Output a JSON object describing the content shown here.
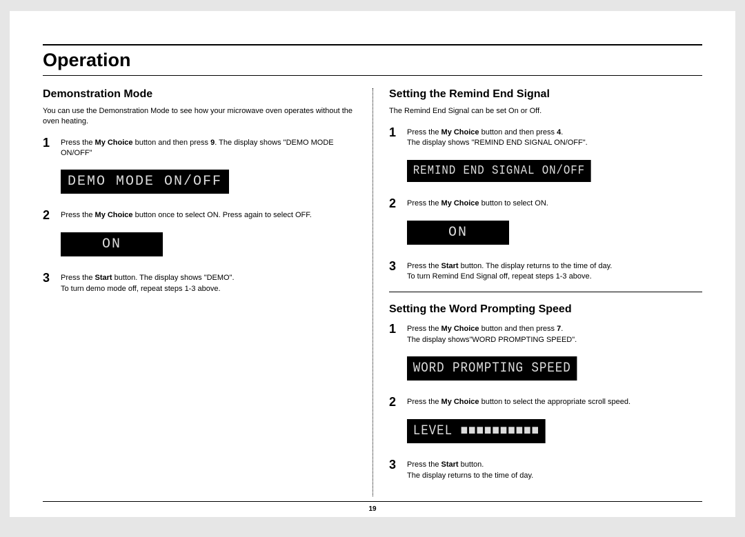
{
  "section_title": "Operation",
  "page_number": "19",
  "left": {
    "demo": {
      "heading": "Demonstration Mode",
      "intro": "You can use the Demonstration Mode to see how your microwave oven operates without the oven heating.",
      "s1_pre": "Press the ",
      "s1_btn": "My Choice",
      "s1_mid": " button and then press ",
      "s1_num": "9",
      "s1_post": ". The display shows \"DEMO MODE ON/OFF\"",
      "lcd1": "DEMO MODE ON/OFF",
      "s2_pre": "Press the ",
      "s2_btn": "My Choice",
      "s2_post": " button once to select ON. Press again to select OFF.",
      "lcd2": "ON",
      "s3_pre": "Press the ",
      "s3_btn": "Start",
      "s3_mid": " button. The display shows \"DEMO\".",
      "s3_line2": "To turn demo mode off, repeat steps 1-3 above."
    }
  },
  "right": {
    "remind": {
      "heading": "Setting the Remind End Signal",
      "intro": "The Remind End Signal can be set On or Off.",
      "s1_pre": "Press the ",
      "s1_btn": "My Choice",
      "s1_mid": " button and then press ",
      "s1_num": "4",
      "s1_post": ".",
      "s1_line2": "The display shows \"REMIND END SIGNAL ON/OFF\".",
      "lcd1": "REMIND END SIGNAL ON/OFF",
      "s2_pre": "Press the ",
      "s2_btn": "My Choice",
      "s2_post": " button to select ON.",
      "lcd2": "ON",
      "s3_pre": "Press the ",
      "s3_btn": "Start",
      "s3_post": " button. The display returns to the time of day.",
      "s3_line2": "To turn Remind End Signal off, repeat steps 1-3 above."
    },
    "speed": {
      "heading": "Setting the Word Prompting Speed",
      "s1_pre": "Press the ",
      "s1_btn": "My Choice",
      "s1_mid": " button and then press ",
      "s1_num": "7",
      "s1_post": ".",
      "s1_line2": "The display shows\"WORD PROMPTING SPEED\".",
      "lcd1": "WORD PROMPTING SPEED",
      "s2_pre": "Press the ",
      "s2_btn": "My Choice",
      "s2_post": " button to select the appropriate scroll speed.",
      "lcd2": "LEVEL ■■■■■■■■■■",
      "s3_pre": "Press the ",
      "s3_btn": "Start",
      "s3_post": " button.",
      "s3_line2": "The display returns to the time of day."
    }
  }
}
